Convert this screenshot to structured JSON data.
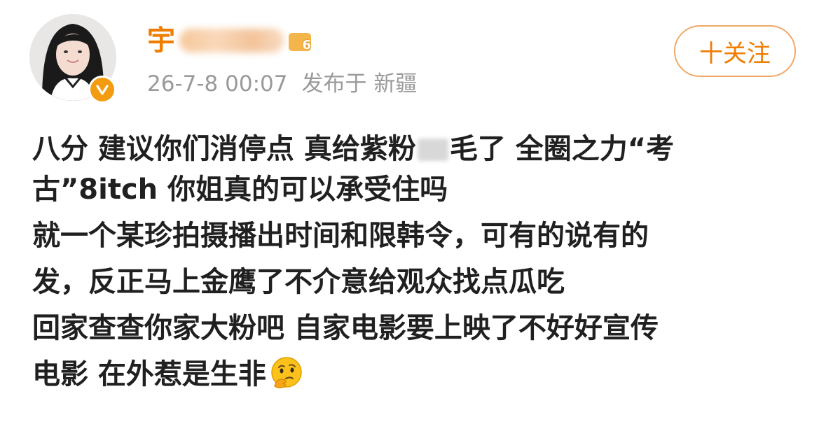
{
  "header": {
    "username_visible": "宇",
    "level_badge": "6",
    "timestamp": "26-7-8 00:07",
    "location_label": "发布于 新疆"
  },
  "follow_button": {
    "label": "十关注"
  },
  "post": {
    "line1_a": "八分 建议你们消停点 真给紫粉",
    "line1_b": "毛了 全圈之力“考",
    "line2": "古”8itch 你姐真的可以承受住吗",
    "line3": "就一个某珍拍摄播出时间和限韩令，可有的说有的",
    "line4": "发，反正马上金鹰了不介意给观众找点瓜吃",
    "line5": "回家查查你家大粉吧 自家电影要上映了不好好宣传",
    "line6": "电影 在外惹是生非",
    "emoji_name": "thinking-face-emoji"
  },
  "colors": {
    "accent": "#f07c00",
    "meta_text": "#9a9a9a",
    "body_text": "#202020",
    "follow_border": "#f0a868",
    "verified_badge": "#f39c12"
  }
}
